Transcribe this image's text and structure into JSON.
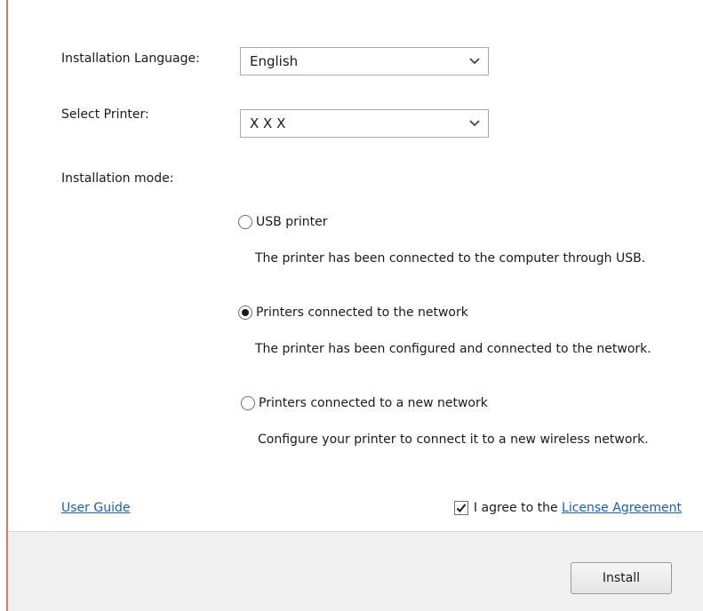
{
  "form": {
    "language_label": "Installation Language:",
    "language_value": "English",
    "printer_label": "Select Printer:",
    "printer_value": "X X X",
    "mode_label": "Installation mode:"
  },
  "modes": [
    {
      "label": "USB printer",
      "description": "The printer has been connected to the computer through USB.",
      "checked": false
    },
    {
      "label": "Printers connected to the network",
      "description": "The printer has been configured and connected to the network.",
      "checked": true
    },
    {
      "label": "Printers connected to a new network",
      "description": "Configure your printer to connect it to a new wireless network.",
      "checked": false
    }
  ],
  "links": {
    "user_guide": "User Guide",
    "agree_text": "I agree to the ",
    "license": "License Agreement",
    "agree_checked": true
  },
  "footer": {
    "install_label": "Install"
  },
  "colors": {
    "link": "#1a5fb4",
    "window_border": "#e07a5a",
    "footer_bg": "#f0f0f0"
  },
  "icons": {
    "dropdown": "chevron-down-icon",
    "checkbox": "checkmark-icon"
  }
}
